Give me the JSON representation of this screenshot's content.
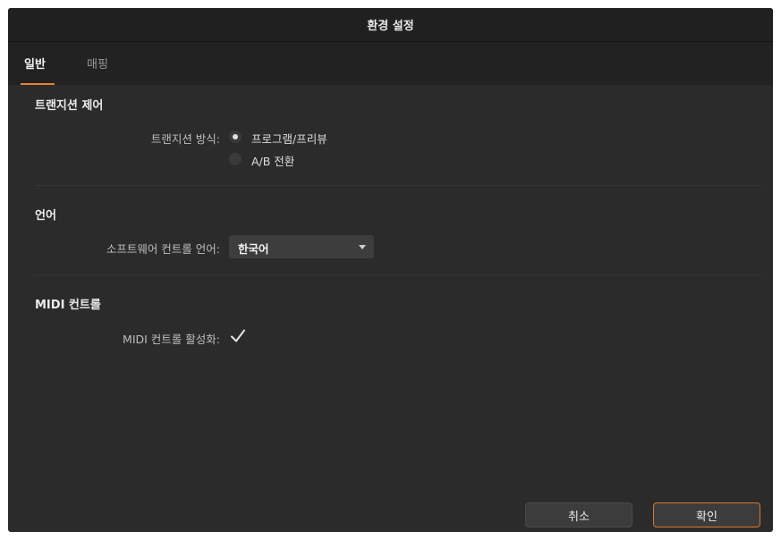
{
  "window": {
    "title": "환경 설정"
  },
  "tabs": [
    {
      "label": "일반",
      "active": true
    },
    {
      "label": "매핑",
      "active": false
    }
  ],
  "transition": {
    "section_title": "트랜지션 제어",
    "label": "트랜지션 방식:",
    "options": [
      {
        "label": "프로그램/프리뷰",
        "selected": true
      },
      {
        "label": "A/B 전환",
        "selected": false
      }
    ]
  },
  "language": {
    "section_title": "언어",
    "label": "소프트웨어 컨트롤 언어:",
    "value": "한국어"
  },
  "midi": {
    "section_title": "MIDI 컨트롤",
    "label": "MIDI 컨트롤 활성화:",
    "enabled": true
  },
  "buttons": {
    "cancel": "취소",
    "ok": "확인"
  },
  "colors": {
    "accent": "#e8822e",
    "background": "#2b2b2b",
    "titlebar": "#202020"
  }
}
